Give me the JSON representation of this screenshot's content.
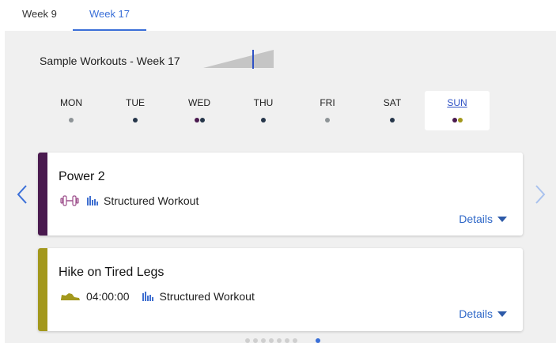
{
  "tabs": [
    {
      "label": "Week 9",
      "active": false
    },
    {
      "label": "Week 17",
      "active": true
    }
  ],
  "header": {
    "title": "Sample Workouts - Week 17"
  },
  "days": [
    {
      "label": "MON",
      "dots": [
        "#8e9497"
      ],
      "selected": false
    },
    {
      "label": "TUE",
      "dots": [
        "#26364a"
      ],
      "selected": false
    },
    {
      "label": "WED",
      "dots": [
        "#4a1a4f",
        "#26364a"
      ],
      "selected": false
    },
    {
      "label": "THU",
      "dots": [
        "#26364a"
      ],
      "selected": false
    },
    {
      "label": "FRI",
      "dots": [
        "#8e9497"
      ],
      "selected": false
    },
    {
      "label": "SAT",
      "dots": [
        "#26364a"
      ],
      "selected": false
    },
    {
      "label": "SUN",
      "dots": [
        "#4a1a4f",
        "#a3981c"
      ],
      "selected": true
    }
  ],
  "workouts": [
    {
      "title": "Power 2",
      "icon": "dumbbell-icon",
      "color": "#4a1a4f",
      "duration": "",
      "type": "Structured Workout",
      "details": "Details"
    },
    {
      "title": "Hike on Tired Legs",
      "icon": "shoe-icon",
      "color": "#a3981c",
      "duration": "04:00:00",
      "type": "Structured Workout",
      "details": "Details"
    }
  ],
  "pager": {
    "count": 8,
    "active_index": 7
  },
  "colors": {
    "accent": "#3a6fd8",
    "link": "#2f68c8",
    "panel": "#f0f0f0"
  }
}
